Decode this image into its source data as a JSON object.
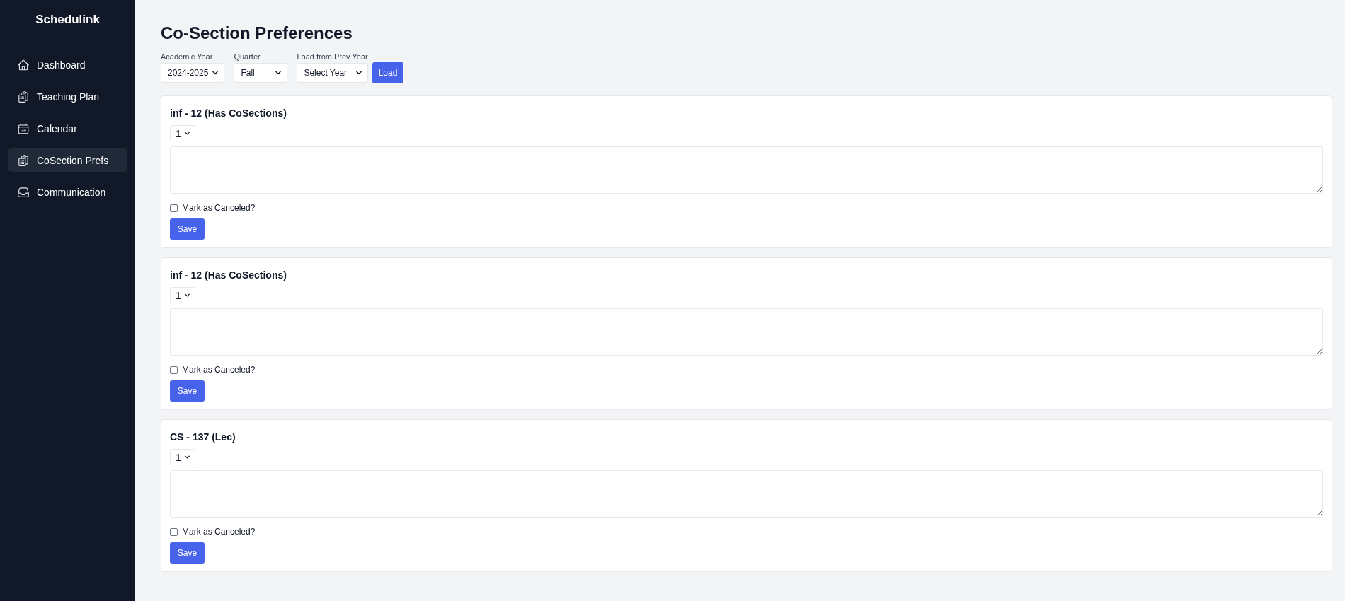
{
  "app": {
    "name": "Schedulink"
  },
  "sidebar": {
    "items": [
      {
        "label": "Dashboard",
        "selected": false
      },
      {
        "label": "Teaching Plan",
        "selected": false
      },
      {
        "label": "Calendar",
        "selected": false
      },
      {
        "label": "CoSection Prefs",
        "selected": true
      },
      {
        "label": "Communication",
        "selected": false
      }
    ]
  },
  "page": {
    "title": "Co-Section Preferences"
  },
  "filters": [
    {
      "label": "Academic Year",
      "value": "2024-2025"
    },
    {
      "label": "Quarter",
      "value": "Fall"
    },
    {
      "label": "Load from Prev Year",
      "value": "Select Year"
    }
  ],
  "load_button": "Load",
  "sections": [
    {
      "title": "inf - 12 (Has CoSections)",
      "number": "1",
      "canceled": false,
      "cancel_label": "Mark as Canceled?",
      "save_button": "Save"
    },
    {
      "title": "inf - 12 (Has CoSections)",
      "number": "1",
      "canceled": false,
      "cancel_label": "Mark as Canceled?",
      "save_button": "Save"
    },
    {
      "title": "CS - 137 (Lec)",
      "number": "1",
      "canceled": false,
      "cancel_label": "Mark as Canceled?",
      "save_button": "Save"
    }
  ]
}
